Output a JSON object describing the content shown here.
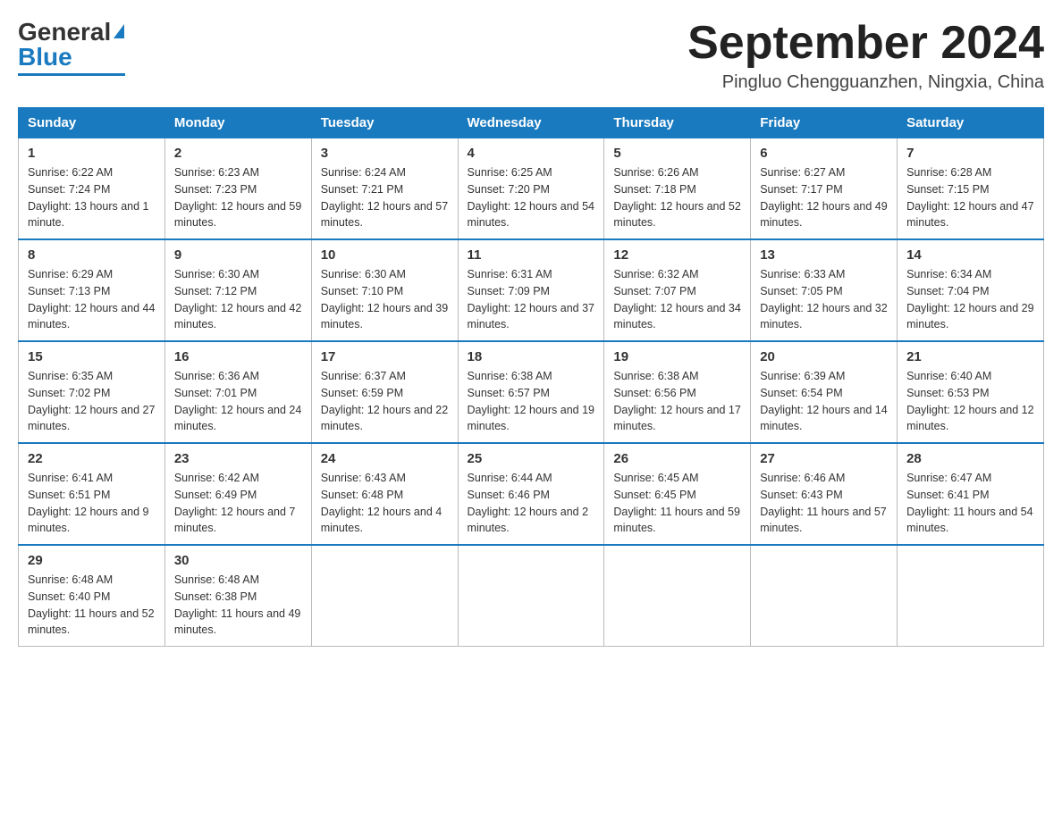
{
  "header": {
    "logo_general": "General",
    "logo_blue": "Blue",
    "month_title": "September 2024",
    "location": "Pingluo Chengguanzhen, Ningxia, China"
  },
  "days_of_week": [
    "Sunday",
    "Monday",
    "Tuesday",
    "Wednesday",
    "Thursday",
    "Friday",
    "Saturday"
  ],
  "weeks": [
    [
      {
        "day": "1",
        "sunrise": "Sunrise: 6:22 AM",
        "sunset": "Sunset: 7:24 PM",
        "daylight": "Daylight: 13 hours and 1 minute."
      },
      {
        "day": "2",
        "sunrise": "Sunrise: 6:23 AM",
        "sunset": "Sunset: 7:23 PM",
        "daylight": "Daylight: 12 hours and 59 minutes."
      },
      {
        "day": "3",
        "sunrise": "Sunrise: 6:24 AM",
        "sunset": "Sunset: 7:21 PM",
        "daylight": "Daylight: 12 hours and 57 minutes."
      },
      {
        "day": "4",
        "sunrise": "Sunrise: 6:25 AM",
        "sunset": "Sunset: 7:20 PM",
        "daylight": "Daylight: 12 hours and 54 minutes."
      },
      {
        "day": "5",
        "sunrise": "Sunrise: 6:26 AM",
        "sunset": "Sunset: 7:18 PM",
        "daylight": "Daylight: 12 hours and 52 minutes."
      },
      {
        "day": "6",
        "sunrise": "Sunrise: 6:27 AM",
        "sunset": "Sunset: 7:17 PM",
        "daylight": "Daylight: 12 hours and 49 minutes."
      },
      {
        "day": "7",
        "sunrise": "Sunrise: 6:28 AM",
        "sunset": "Sunset: 7:15 PM",
        "daylight": "Daylight: 12 hours and 47 minutes."
      }
    ],
    [
      {
        "day": "8",
        "sunrise": "Sunrise: 6:29 AM",
        "sunset": "Sunset: 7:13 PM",
        "daylight": "Daylight: 12 hours and 44 minutes."
      },
      {
        "day": "9",
        "sunrise": "Sunrise: 6:30 AM",
        "sunset": "Sunset: 7:12 PM",
        "daylight": "Daylight: 12 hours and 42 minutes."
      },
      {
        "day": "10",
        "sunrise": "Sunrise: 6:30 AM",
        "sunset": "Sunset: 7:10 PM",
        "daylight": "Daylight: 12 hours and 39 minutes."
      },
      {
        "day": "11",
        "sunrise": "Sunrise: 6:31 AM",
        "sunset": "Sunset: 7:09 PM",
        "daylight": "Daylight: 12 hours and 37 minutes."
      },
      {
        "day": "12",
        "sunrise": "Sunrise: 6:32 AM",
        "sunset": "Sunset: 7:07 PM",
        "daylight": "Daylight: 12 hours and 34 minutes."
      },
      {
        "day": "13",
        "sunrise": "Sunrise: 6:33 AM",
        "sunset": "Sunset: 7:05 PM",
        "daylight": "Daylight: 12 hours and 32 minutes."
      },
      {
        "day": "14",
        "sunrise": "Sunrise: 6:34 AM",
        "sunset": "Sunset: 7:04 PM",
        "daylight": "Daylight: 12 hours and 29 minutes."
      }
    ],
    [
      {
        "day": "15",
        "sunrise": "Sunrise: 6:35 AM",
        "sunset": "Sunset: 7:02 PM",
        "daylight": "Daylight: 12 hours and 27 minutes."
      },
      {
        "day": "16",
        "sunrise": "Sunrise: 6:36 AM",
        "sunset": "Sunset: 7:01 PM",
        "daylight": "Daylight: 12 hours and 24 minutes."
      },
      {
        "day": "17",
        "sunrise": "Sunrise: 6:37 AM",
        "sunset": "Sunset: 6:59 PM",
        "daylight": "Daylight: 12 hours and 22 minutes."
      },
      {
        "day": "18",
        "sunrise": "Sunrise: 6:38 AM",
        "sunset": "Sunset: 6:57 PM",
        "daylight": "Daylight: 12 hours and 19 minutes."
      },
      {
        "day": "19",
        "sunrise": "Sunrise: 6:38 AM",
        "sunset": "Sunset: 6:56 PM",
        "daylight": "Daylight: 12 hours and 17 minutes."
      },
      {
        "day": "20",
        "sunrise": "Sunrise: 6:39 AM",
        "sunset": "Sunset: 6:54 PM",
        "daylight": "Daylight: 12 hours and 14 minutes."
      },
      {
        "day": "21",
        "sunrise": "Sunrise: 6:40 AM",
        "sunset": "Sunset: 6:53 PM",
        "daylight": "Daylight: 12 hours and 12 minutes."
      }
    ],
    [
      {
        "day": "22",
        "sunrise": "Sunrise: 6:41 AM",
        "sunset": "Sunset: 6:51 PM",
        "daylight": "Daylight: 12 hours and 9 minutes."
      },
      {
        "day": "23",
        "sunrise": "Sunrise: 6:42 AM",
        "sunset": "Sunset: 6:49 PM",
        "daylight": "Daylight: 12 hours and 7 minutes."
      },
      {
        "day": "24",
        "sunrise": "Sunrise: 6:43 AM",
        "sunset": "Sunset: 6:48 PM",
        "daylight": "Daylight: 12 hours and 4 minutes."
      },
      {
        "day": "25",
        "sunrise": "Sunrise: 6:44 AM",
        "sunset": "Sunset: 6:46 PM",
        "daylight": "Daylight: 12 hours and 2 minutes."
      },
      {
        "day": "26",
        "sunrise": "Sunrise: 6:45 AM",
        "sunset": "Sunset: 6:45 PM",
        "daylight": "Daylight: 11 hours and 59 minutes."
      },
      {
        "day": "27",
        "sunrise": "Sunrise: 6:46 AM",
        "sunset": "Sunset: 6:43 PM",
        "daylight": "Daylight: 11 hours and 57 minutes."
      },
      {
        "day": "28",
        "sunrise": "Sunrise: 6:47 AM",
        "sunset": "Sunset: 6:41 PM",
        "daylight": "Daylight: 11 hours and 54 minutes."
      }
    ],
    [
      {
        "day": "29",
        "sunrise": "Sunrise: 6:48 AM",
        "sunset": "Sunset: 6:40 PM",
        "daylight": "Daylight: 11 hours and 52 minutes."
      },
      {
        "day": "30",
        "sunrise": "Sunrise: 6:48 AM",
        "sunset": "Sunset: 6:38 PM",
        "daylight": "Daylight: 11 hours and 49 minutes."
      },
      null,
      null,
      null,
      null,
      null
    ]
  ]
}
